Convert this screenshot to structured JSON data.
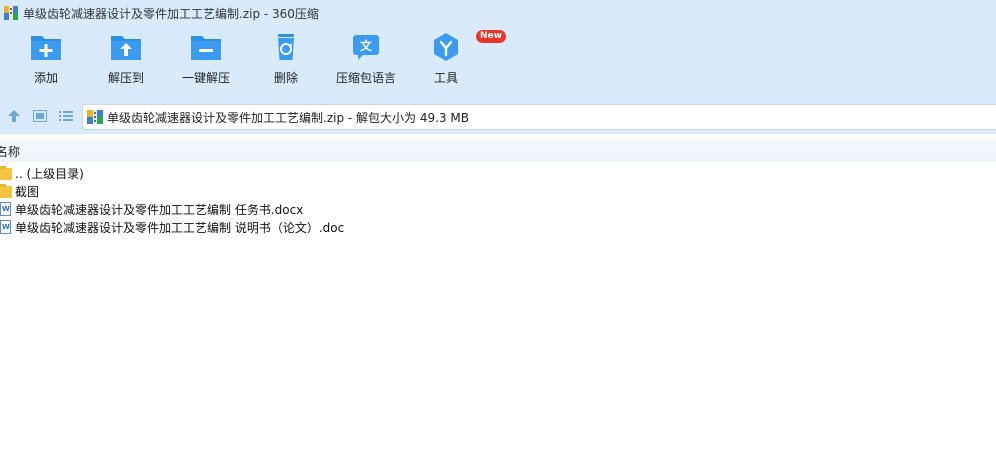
{
  "window": {
    "title": "单级齿轮减速器设计及零件加工工艺编制.zip - 360压缩"
  },
  "colors": {
    "chrome_bg": "#d9ebfa",
    "icon_blue": "#2d8fe6",
    "badge_red": "#e8362a",
    "folder_yellow": "#f5c542"
  },
  "toolbar": {
    "items": [
      {
        "label": "添加",
        "icon": "add-icon"
      },
      {
        "label": "解压到",
        "icon": "extract-to-icon"
      },
      {
        "label": "一键解压",
        "icon": "one-click-extract-icon"
      },
      {
        "label": "删除",
        "icon": "recycle-bin-icon"
      },
      {
        "label": "压缩包语言",
        "icon": "archive-language-icon"
      },
      {
        "label": "工具",
        "icon": "tools-icon",
        "badge": "New"
      }
    ]
  },
  "address": {
    "path": "单级齿轮减速器设计及零件加工工艺编制.zip - 解包大小为 49.3 MB"
  },
  "list": {
    "column_name": "名称",
    "rows": [
      {
        "name": ".. (上级目录)",
        "type": "folder"
      },
      {
        "name": "截图",
        "type": "folder"
      },
      {
        "name": "单级齿轮减速器设计及零件加工工艺编制 任务书.docx",
        "type": "doc"
      },
      {
        "name": "单级齿轮减速器设计及零件加工工艺编制 说明书（论文）.doc",
        "type": "doc"
      }
    ]
  }
}
